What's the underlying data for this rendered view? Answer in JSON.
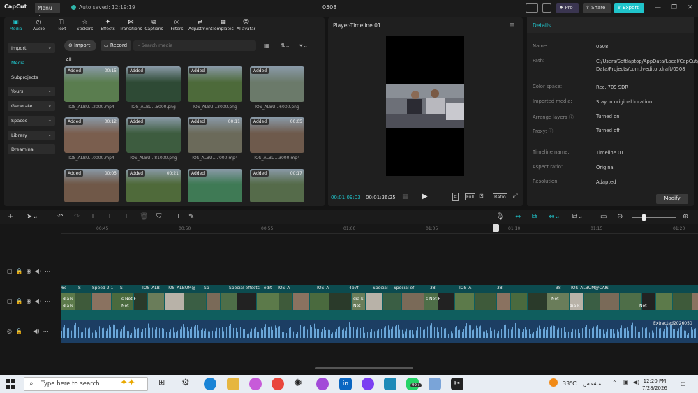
{
  "app": {
    "logo": "CapCut",
    "menu": "Menu",
    "autosave": "Auto saved: 12:19:19",
    "project": "0508",
    "pro": "Pro",
    "share": "Share",
    "export": "Export"
  },
  "media_tabs": [
    {
      "icon": "▣",
      "label": "Media"
    },
    {
      "icon": "◷",
      "label": "Audio"
    },
    {
      "icon": "TI",
      "label": "Text"
    },
    {
      "icon": "☆",
      "label": "Stickers"
    },
    {
      "icon": "✦",
      "label": "Effects"
    },
    {
      "icon": "⋈",
      "label": "Transitions"
    },
    {
      "icon": "⧉",
      "label": "Captions"
    },
    {
      "icon": "◎",
      "label": "Filters"
    },
    {
      "icon": "⇌",
      "label": "Adjustment"
    },
    {
      "icon": "▦",
      "label": "Templates"
    },
    {
      "icon": "☺",
      "label": "AI avatar"
    }
  ],
  "sidebar": [
    "Import",
    "Media",
    "Subprojects",
    "Yours",
    "Generate",
    "Spaces",
    "Library",
    "Dreamina"
  ],
  "media_toolbar": {
    "import": "Import",
    "record": "Record",
    "search_placeholder": "Search media",
    "all": "All"
  },
  "media_items": [
    {
      "badge": "Added",
      "dur": "00:15",
      "name": "IOS_ALBU...2000.mp4",
      "color": "#5a7d4f"
    },
    {
      "badge": "Added",
      "dur": "",
      "name": "IOS_ALBU...5000.png",
      "color": "#2e4a35"
    },
    {
      "badge": "Added",
      "dur": "",
      "name": "IOS_ALBU...3000.png",
      "color": "#4d6a3a"
    },
    {
      "badge": "Added",
      "dur": "",
      "name": "IOS_ALBU...6000.png",
      "color": "#6b7a6a"
    },
    {
      "badge": "Added",
      "dur": "00:12",
      "name": "IOS_ALBU...0000.mp4",
      "color": "#7a5e4e"
    },
    {
      "badge": "Added",
      "dur": "",
      "name": "IOS_ALBU...81000.png",
      "color": "#3d5c3f"
    },
    {
      "badge": "Added",
      "dur": "00:11",
      "name": "IOS_ALBU...7000.mp4",
      "color": "#6b6a5a"
    },
    {
      "badge": "Added",
      "dur": "00:05",
      "name": "IOS_ALBU...3000.mp4",
      "color": "#6e5a4c"
    },
    {
      "badge": "Added",
      "dur": "00:05",
      "name": "",
      "color": "#705848"
    },
    {
      "badge": "Added",
      "dur": "00:21",
      "name": "",
      "color": "#4f6a3a"
    },
    {
      "badge": "Added",
      "dur": "",
      "name": "",
      "color": "#3f7a55"
    },
    {
      "badge": "Added",
      "dur": "00:17",
      "name": "",
      "color": "#556b4a"
    }
  ],
  "player": {
    "title": "Player-Timeline 01",
    "current": "00:01:09:03",
    "total": "00:01:36:25",
    "full": "Full",
    "ratio": "Ratio"
  },
  "details": {
    "title": "Details",
    "rows": [
      {
        "k": "Name:",
        "v": "0508"
      },
      {
        "k": "Path:",
        "v": "C:/Users/Softlaptop/AppData/Local/CapCut/User Data/Projects/com.lveditor.draft/0508"
      },
      {
        "k": "Color space:",
        "v": "Rec. 709 SDR"
      },
      {
        "k": "Imported media:",
        "v": "Stay in original location"
      },
      {
        "k": "Arrange layers ⓘ",
        "v": "Turned on"
      },
      {
        "k": "Proxy: ⓘ",
        "v": "Turned off"
      },
      {
        "k": "Timeline name:",
        "v": "Timeline 01"
      },
      {
        "k": "Aspect ratio:",
        "v": "Original"
      },
      {
        "k": "Resolution:",
        "v": "Adapted"
      }
    ],
    "modify": "Modify"
  },
  "ruler": [
    "00:45",
    "00:50",
    "00:55",
    "01:00",
    "01:05",
    "01:10",
    "01:15",
    "01:20"
  ],
  "clips": [
    "6c",
    "S",
    "Speed 2.1",
    "S",
    "IOS_ALB",
    "IOS_ALBUM@",
    "Sp",
    "Special effects - edit",
    "IOS_A",
    "IOS_A",
    "4b7f",
    "Special",
    "Special ef",
    "38",
    "IOS_A",
    "38",
    "38",
    "IOS_ALBUM@CAP",
    "S"
  ],
  "clip_text": [
    "dia k",
    "s Not F",
    "dia k",
    "s Not F",
    "Not",
    "dia k",
    "Not",
    "dia k",
    "Not",
    "Not"
  ],
  "audio_label": "Extracted2026050",
  "taskbar": {
    "search": "Type here to search",
    "temp": "33°C",
    "weather": "مشمس",
    "time": "12:20 PM",
    "date": "7/28/2026",
    "badge": "99+"
  }
}
